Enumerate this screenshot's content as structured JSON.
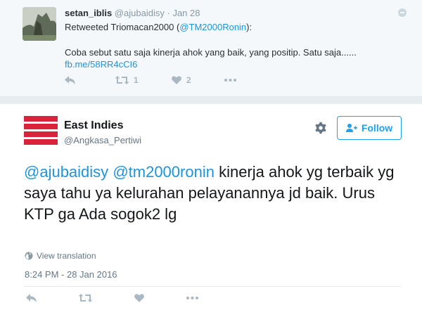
{
  "retweet": {
    "user_name": "setan_iblis",
    "user_handle": "@ajubaidisy",
    "separator": "·",
    "date": "Jan 28",
    "retweeted_prefix": "Retweeted Triomacan2000 (",
    "retweeted_handle": "@TM2000Ronin",
    "retweeted_suffix": "):",
    "text": "Coba sebut satu saja kinerja ahok yang baik, yang positip. Satu saja......",
    "link": "fb.me/58RR4cCI6",
    "retweet_count": "1",
    "like_count": "2"
  },
  "tweet": {
    "user_name": "East Indies",
    "user_handle": "@Angkasa_Pertiwi",
    "follow_label": "Follow",
    "mention_1": "@ajubaidisy",
    "mention_2": "@tm2000ronin",
    "text": " kinerja ahok yg terbaik yg saya tahu ya kelurahan pelayanannya jd baik. Urus KTP ga Ada sogok2 lg",
    "view_translation": "View translation",
    "timestamp": "8:24 PM - 28 Jan 2016"
  },
  "colors": {
    "link": "#1b95e0",
    "follow_blue": "#1da1f2",
    "logo_red": "#d9233a",
    "icon_gray": "#aab8c2"
  }
}
